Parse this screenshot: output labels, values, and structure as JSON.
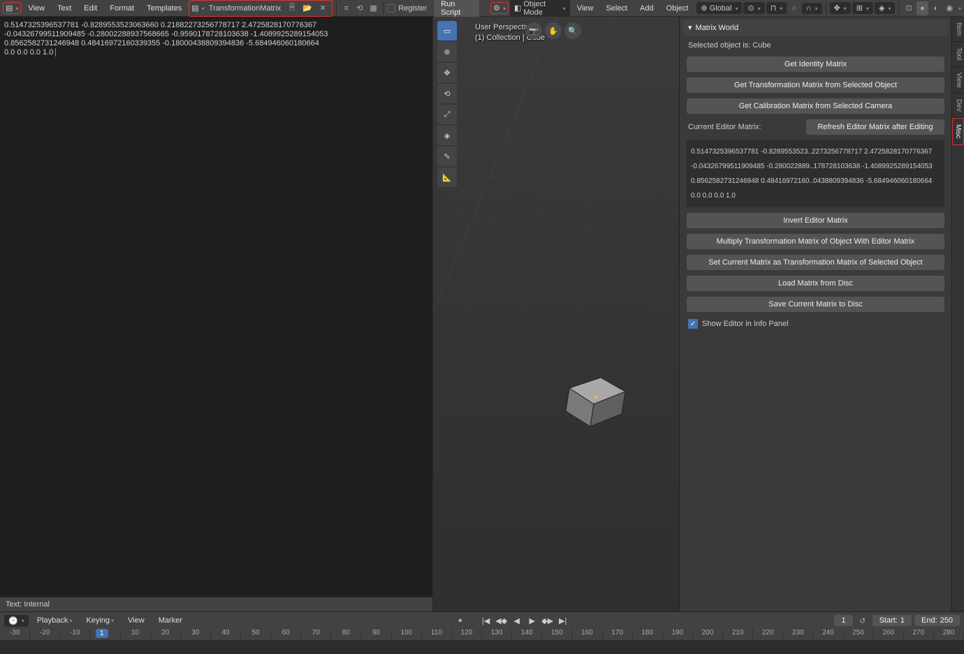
{
  "text_editor": {
    "menus": [
      "View",
      "Text",
      "Edit",
      "Format",
      "Templates"
    ],
    "filename": "TransformationMatrix",
    "register_label": "Register",
    "run_label": "Run Script",
    "content_lines": [
      "0.5147325396537781 -0.8289553523063660 0.21882273256778717 2.4725828170776367",
      "-0.04326799511909485 -0.28002288937568665 -0.9590178728103638 -1.4089925289154053",
      "0.8562582731246948 0.48416972160339355 -0.18000438809394836 -5.684946060180664",
      "0.0 0.0 0.0 1.0"
    ],
    "footer": "Text: Internal"
  },
  "viewport": {
    "mode": "Object Mode",
    "header_menus": [
      "View",
      "Select",
      "Add",
      "Object"
    ],
    "orientation": "Global",
    "overlay_line1": "User Perspective",
    "overlay_line2": "(1) Collection | Cube"
  },
  "npanel": {
    "title": "Matrix World",
    "selected_object": "Selected object is: Cube",
    "btn_identity": "Get Identity Matrix",
    "btn_get_transform": "Get Transformation Matrix from Selected Object",
    "btn_get_calib": "Get Calibration Matrix from Selected Camera",
    "current_matrix_label": "Current Editor Matrix:",
    "btn_refresh": "Refresh Editor Matrix after Editing",
    "matrix_rows": [
      "0.5147325396537781 -0.8289553523..2273256778717 2.4725828170776367",
      "-0.04326799511909485 -0.280022889..178728103638 -1.4089925289154053",
      "0.8562582731246948 0.48416972160..0438809394836 -5.684946060180664",
      "0.0 0.0 0.0 1.0"
    ],
    "btn_invert": "Invert Editor Matrix",
    "btn_multiply": "Multiply Transformation Matrix of Object With Editor Matrix",
    "btn_set_transform": "Set Current Matrix as Transformation Matrix of Selected Object",
    "btn_load": "Load Matrix from Disc",
    "btn_save": "Save Current Matrix to Disc",
    "show_editor_label": "Show Editor in Info Panel",
    "vtabs": [
      "Item",
      "Tool",
      "View",
      "Dev",
      "Misc"
    ]
  },
  "timeline": {
    "menus": [
      "Playback",
      "Keying",
      "View",
      "Marker"
    ],
    "current_frame": "1",
    "start_label": "Start:",
    "start_val": "1",
    "end_label": "End:",
    "end_val": "250",
    "ticks": [
      "-30",
      "-20",
      "-10",
      "1",
      "10",
      "20",
      "30",
      "40",
      "50",
      "60",
      "70",
      "80",
      "90",
      "100",
      "110",
      "120",
      "130",
      "140",
      "150",
      "160",
      "170",
      "180",
      "190",
      "200",
      "210",
      "220",
      "230",
      "240",
      "250",
      "260",
      "270",
      "280"
    ]
  }
}
